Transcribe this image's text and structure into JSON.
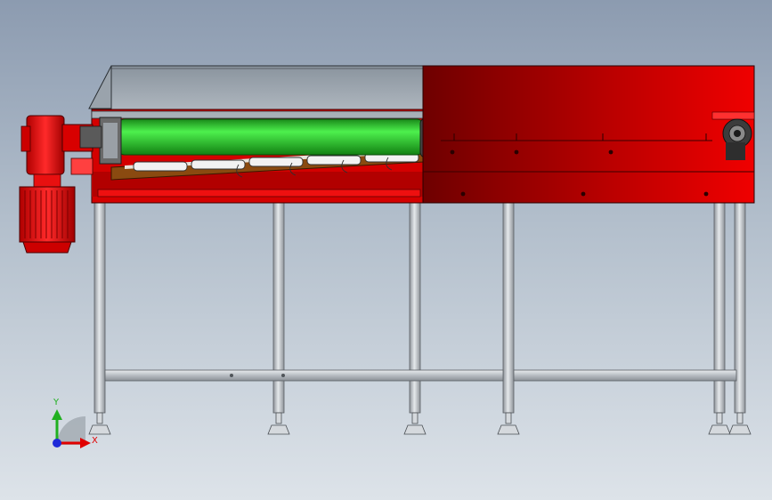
{
  "viewport": {
    "background_top": "#8c9bb0",
    "background_bottom": "#dde3e9"
  },
  "model": {
    "frame_color": "#e00000",
    "frame_dark": "#7a0000",
    "roller_color": "#22cc22",
    "leg_color": "#c4c8cc",
    "belt_color": "#8a4a10"
  },
  "triad": {
    "x_label": "X",
    "y_label": "Y",
    "x_color": "#e00000",
    "y_color": "#20b020",
    "z_color": "#1e2ad8"
  }
}
